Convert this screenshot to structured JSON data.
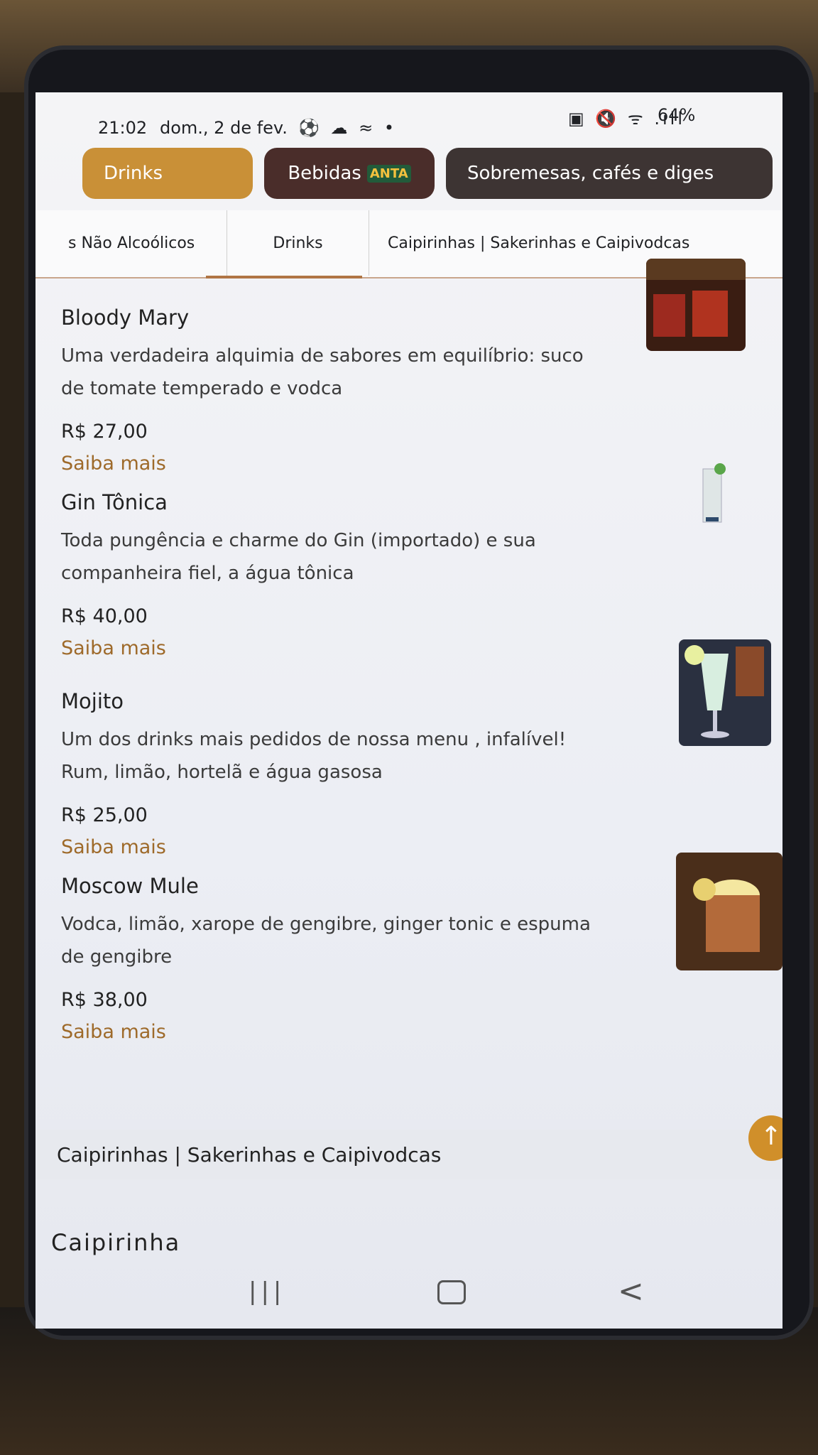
{
  "status_bar": {
    "time": "21:02",
    "date": "dom., 2 de fev.",
    "notif_icons": "⚽ ☁ ≈ •",
    "right_icons": "▣ 🔇 ᯤ .ıll",
    "battery": "64%"
  },
  "top_tabs": [
    {
      "label": "Drinks"
    },
    {
      "label": "Bebidas",
      "badge": "ANTA"
    },
    {
      "label": "Sobremesas, cafés e diges"
    }
  ],
  "sub_tabs": [
    {
      "label": "s Não Alcoólicos"
    },
    {
      "label": "Drinks"
    },
    {
      "label": "Caipirinhas | Sakerinhas e Caipivodcas"
    }
  ],
  "items": [
    {
      "name": "Bloody Mary",
      "desc": "Uma verdadeira alquimia de sabores em equilíbrio: suco de tomate temperado e vodca",
      "price": "R$ 27,00",
      "more": "Saiba mais"
    },
    {
      "name": "Gin Tônica",
      "desc": "Toda pungência e charme do Gin (importado) e sua companheira fiel, a água tônica",
      "price": "R$ 40,00",
      "more": "Saiba mais"
    },
    {
      "name": "Mojito",
      "desc": "Um dos drinks mais pedidos de nossa menu , infalível! Rum, limão, hortelã e água gasosa",
      "price": "R$ 25,00",
      "more": "Saiba mais"
    },
    {
      "name": "Moscow Mule",
      "desc": "Vodca, limão, xarope de gengibre, ginger tonic e espuma de gengibre",
      "price": "R$ 38,00",
      "more": "Saiba mais"
    }
  ],
  "section_title": "Caipirinhas | Sakerinhas e Caipivodcas",
  "next_item_title": "Caipirinha",
  "scroll_top_icon": "↑",
  "nav": {
    "recents": "|||",
    "back": "<"
  }
}
